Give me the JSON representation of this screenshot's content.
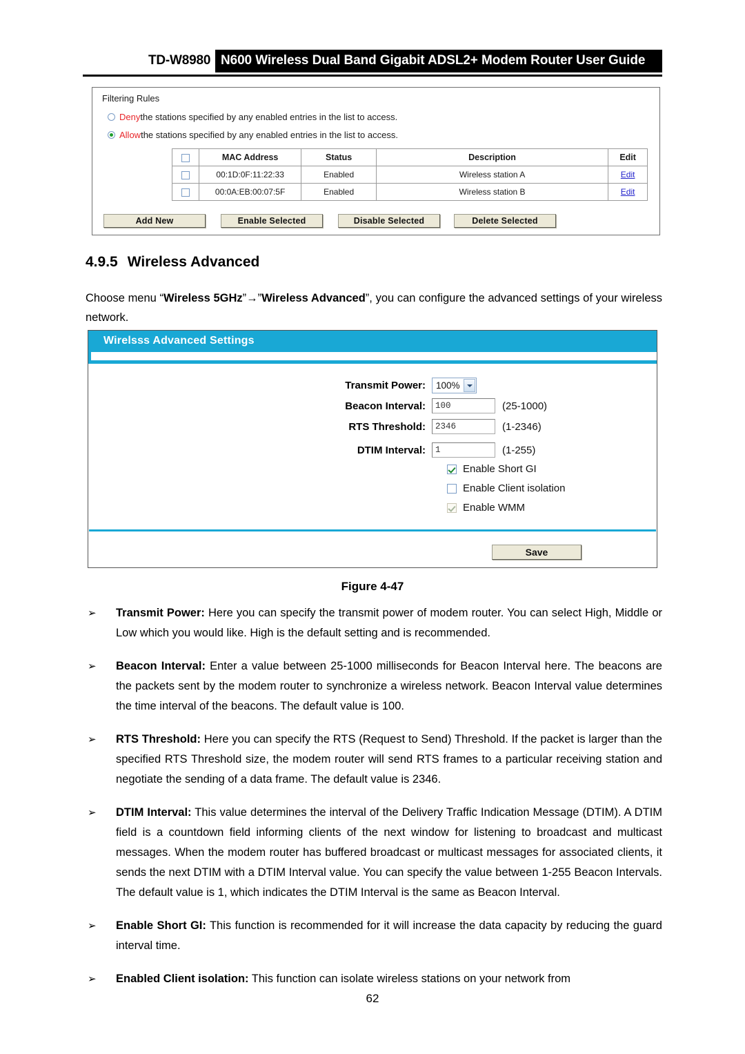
{
  "header": {
    "model": "TD-W8980",
    "title": "N600 Wireless Dual Band Gigabit ADSL2+ Modem Router User Guide"
  },
  "filtering_panel": {
    "title": "Filtering Rules",
    "rules": [
      {
        "keyword": "Deny",
        "rest": " the stations specified by any enabled entries in the list to access.",
        "selected": false
      },
      {
        "keyword": "Allow",
        "rest": " the stations specified by any enabled entries in the list to access.",
        "selected": true
      }
    ],
    "table": {
      "columns": [
        "",
        "MAC Address",
        "Status",
        "Description",
        "Edit"
      ],
      "rows": [
        {
          "mac": "00:1D:0F:11:22:33",
          "status": "Enabled",
          "description": "Wireless station A",
          "edit": "Edit"
        },
        {
          "mac": "00:0A:EB:00:07:5F",
          "status": "Enabled",
          "description": "Wireless station B",
          "edit": "Edit"
        }
      ]
    },
    "buttons": {
      "add_new": "Add New",
      "enable_selected": "Enable Selected",
      "disable_selected": "Disable Selected",
      "delete_selected": "Delete Selected"
    }
  },
  "section": {
    "number": "4.9.5",
    "title": "Wireless Advanced",
    "intro_prefix": "Choose menu “",
    "intro_menu1": "Wireless 5GHz",
    "intro_arrow": "”→”",
    "intro_menu2": "Wireless Advanced",
    "intro_suffix": "”, you can configure the advanced settings of your wireless network."
  },
  "advanced_panel": {
    "header_title": "Wirelsss Advanced Settings",
    "fields": {
      "transmit_power": {
        "label": "Transmit Power:",
        "value": "100%",
        "hint": ""
      },
      "beacon_interval": {
        "label": "Beacon Interval:",
        "value": "100",
        "hint": "(25-1000)"
      },
      "rts_threshold": {
        "label": "RTS Threshold:",
        "value": "2346",
        "hint": "(1-2346)"
      },
      "dtim_interval": {
        "label": "DTIM Interval:",
        "value": "1",
        "hint": "(1-255)"
      }
    },
    "checkboxes": [
      {
        "label": "Enable Short GI",
        "checked": true,
        "disabled": false
      },
      {
        "label": "Enable Client isolation",
        "checked": false,
        "disabled": false
      },
      {
        "label": "Enable WMM",
        "checked": true,
        "disabled": true
      }
    ],
    "save_label": "Save"
  },
  "figure_caption": "Figure 4-47",
  "bullets": [
    {
      "arrow": "➢",
      "term": "Transmit Power:",
      "text": " Here you can specify the transmit power of modem router. You can select High, Middle or Low which you would like. High is the default setting and is recommended."
    },
    {
      "arrow": "➢",
      "term": "Beacon Interval:",
      "text": " Enter a value between 25-1000 milliseconds for Beacon Interval here. The beacons are the packets sent by the modem router to synchronize a wireless network. Beacon Interval value determines the time interval of the beacons. The default value is 100."
    },
    {
      "arrow": "➢",
      "term": "RTS Threshold:",
      "text": " Here you can specify the RTS (Request to Send) Threshold. If the packet is larger than the specified RTS Threshold size, the modem router will send RTS frames to a particular receiving station and negotiate the sending of a data frame. The default value is 2346."
    },
    {
      "arrow": "➢",
      "term": "DTIM Interval:",
      "text": " This value determines the interval of the Delivery Traffic Indication Message (DTIM). A DTIM field is a countdown field informing clients of the next window for listening to broadcast and multicast messages. When the modem router has buffered broadcast or multicast messages for associated clients, it sends the next DTIM with a DTIM Interval value. You can specify the value between 1-255 Beacon Intervals. The default value is 1, which indicates the DTIM Interval is the same as Beacon Interval."
    },
    {
      "arrow": "➢",
      "term": "Enable Short GI:",
      "text": " This function is recommended for it will increase the data capacity by reducing the guard interval time."
    },
    {
      "arrow": "➢",
      "term": "Enabled Client isolation:",
      "text": " This function can isolate wireless stations on your network from"
    }
  ],
  "page_number": "62",
  "colors": {
    "panel_header": "#19A8D5",
    "keyword_red": "#E8262A",
    "link_blue": "#2222CC",
    "button_face": "#ECE9D8"
  }
}
